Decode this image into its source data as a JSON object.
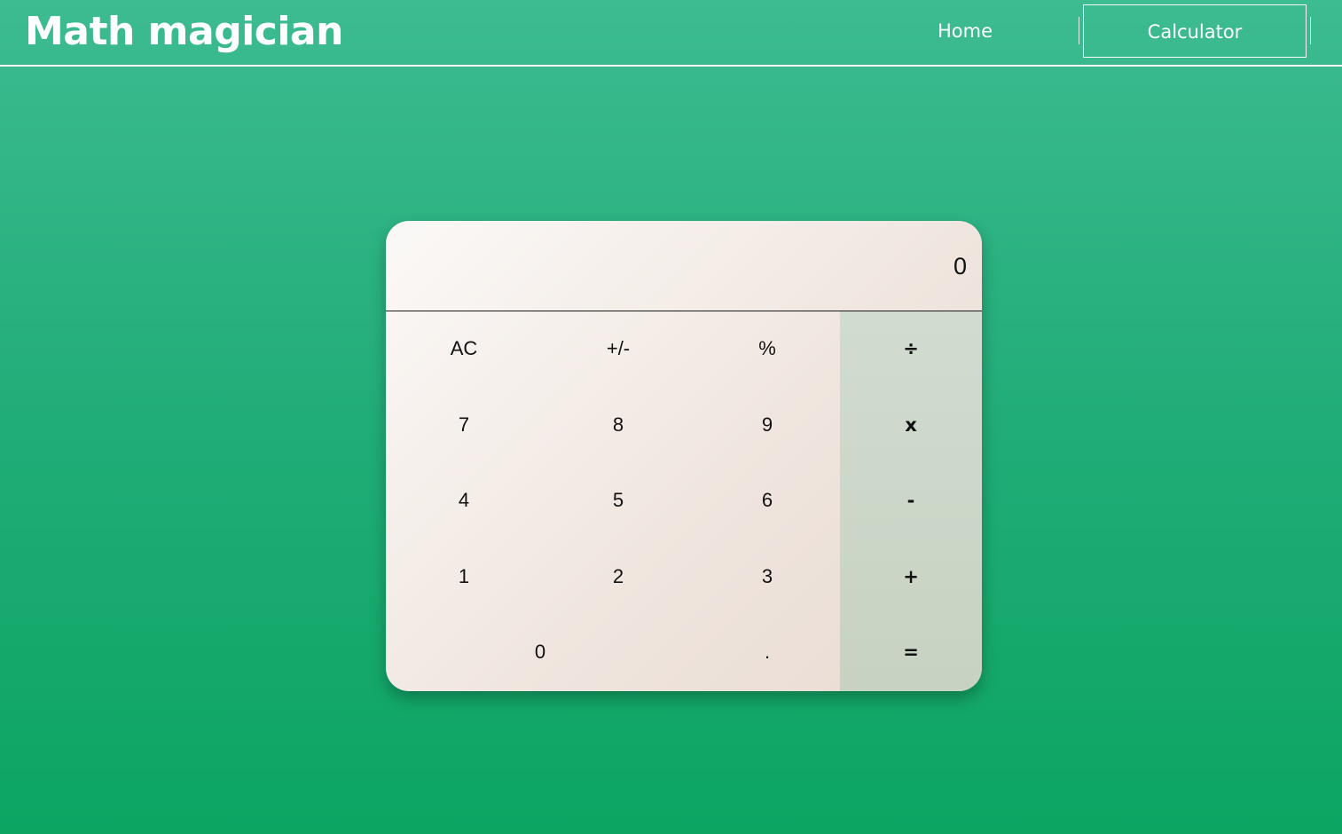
{
  "header": {
    "brand": "Math magician",
    "nav": {
      "home": "Home",
      "calculator": "Calculator"
    }
  },
  "calculator": {
    "display": "0",
    "keys": {
      "clear": "AC",
      "sign": "+/-",
      "percent": "%",
      "divide": "÷",
      "seven": "7",
      "eight": "8",
      "nine": "9",
      "multiply": "x",
      "four": "4",
      "five": "5",
      "six": "6",
      "subtract": "-",
      "one": "1",
      "two": "2",
      "three": "3",
      "add": "+",
      "zero": "0",
      "decimal": ".",
      "equals": "="
    }
  },
  "colors": {
    "background_top": "#3dbb91",
    "background_bottom": "#0ca562",
    "operator_column": "#cdd8cb",
    "text": "#111111"
  }
}
